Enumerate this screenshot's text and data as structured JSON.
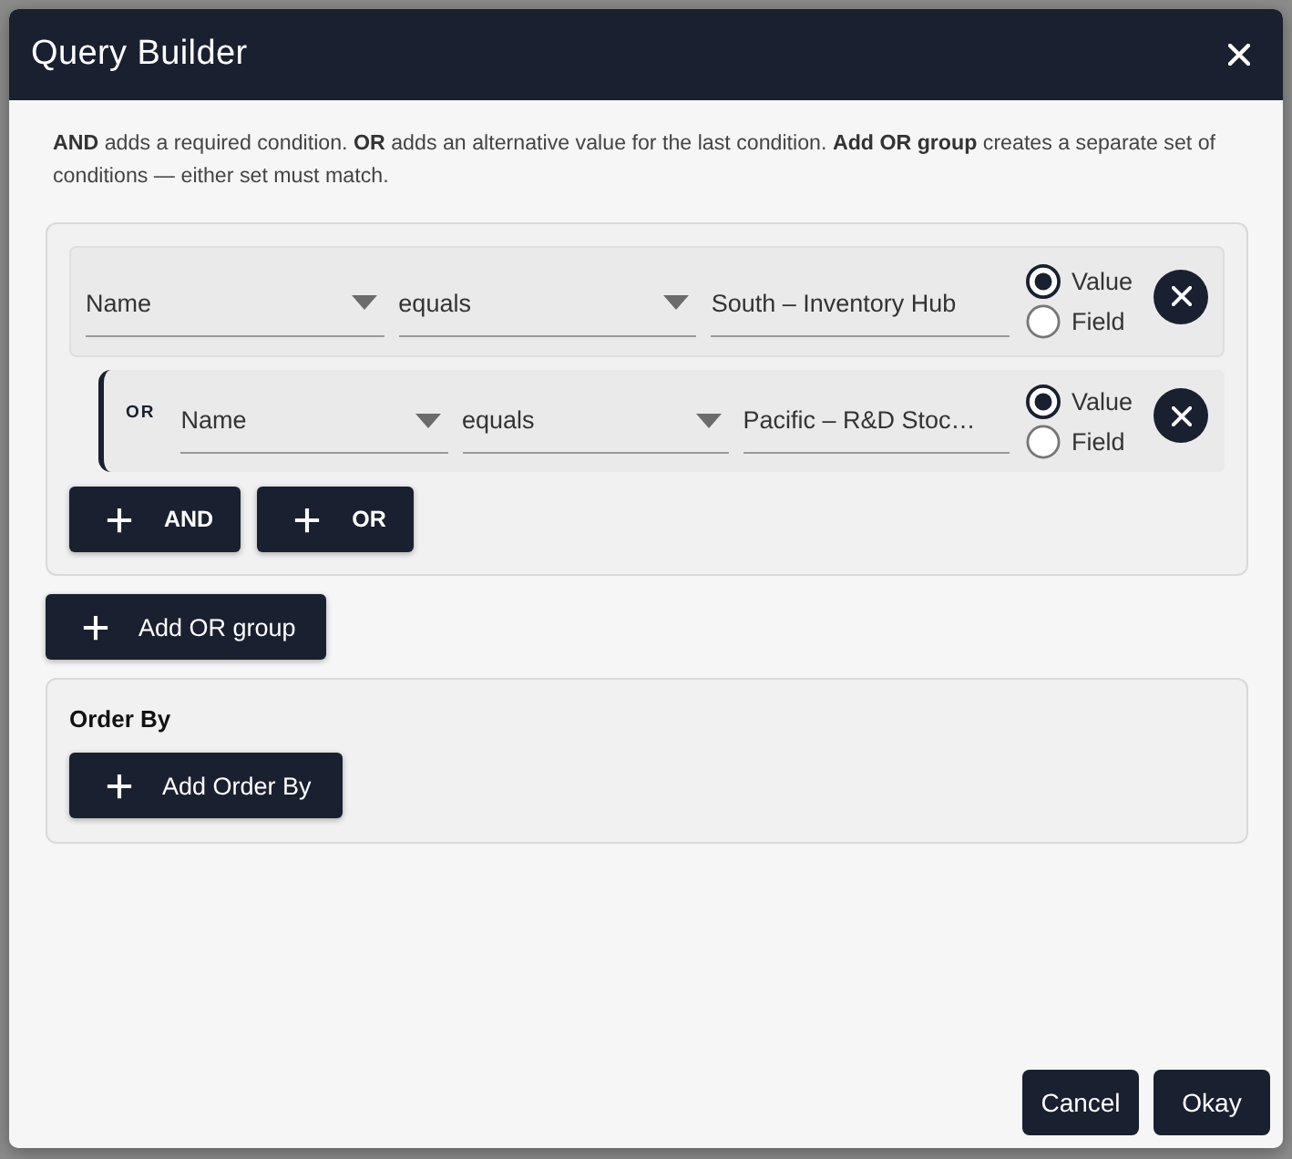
{
  "dialog": {
    "title": "Query Builder"
  },
  "description": "**AND** adds a required condition. **OR** adds an alternative value for the last condition. **Add OR group** creates a separate set of conditions — either set must match.",
  "groups": [
    {
      "conditions": [
        {
          "kind": "condition",
          "field": "Name",
          "operator": "equals",
          "value": "South – Inventory Hub",
          "source": [
            {
              "label": "Value",
              "selected": true
            },
            {
              "label": "Field",
              "selected": false
            }
          ]
        },
        {
          "kind": "or",
          "connector": "OR",
          "field": "Name",
          "operator": "equals",
          "value": "Pacific – R&D Stoc…",
          "source": [
            {
              "label": "Value",
              "selected": true
            },
            {
              "label": "Field",
              "selected": false
            }
          ]
        }
      ],
      "add_buttons": [
        "AND",
        "OR"
      ]
    }
  ],
  "add_group_button": "Add OR group",
  "order_by": {
    "title": "Order By",
    "button": "Add Order By"
  },
  "footer_buttons": [
    "Cancel",
    "Okay"
  ]
}
